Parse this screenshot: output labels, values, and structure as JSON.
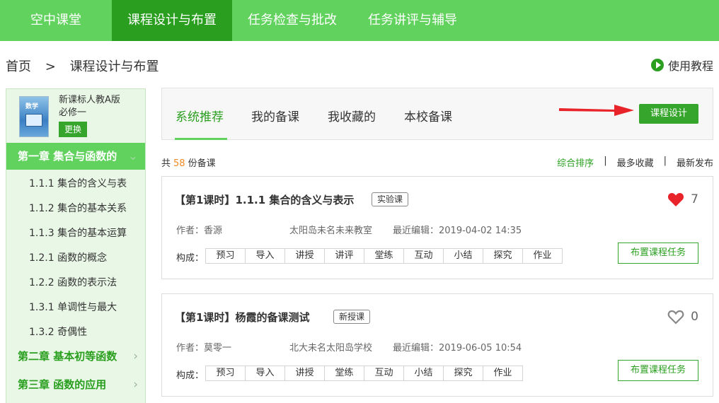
{
  "nav": {
    "brand": "空中课堂",
    "items": [
      "课程设计与布置",
      "任务检查与批改",
      "任务讲评与辅导"
    ]
  },
  "breadcrumb": {
    "home": "首页",
    "separator": ">",
    "current": "课程设计与布置"
  },
  "tutorial_link": "使用教程",
  "sidebar": {
    "book_cover_text": "数学",
    "book_title_line1": "新课标人教A版",
    "book_title_line2": "必修一",
    "swap_label": "更换",
    "chapters": [
      {
        "label": "第一章 集合与函数的",
        "active": true
      },
      {
        "label": "第二章 基本初等函数",
        "active": false
      },
      {
        "label": "第三章 函数的应用",
        "active": false
      }
    ],
    "sections": [
      "1.1.1 集合的含义与表",
      "1.1.2 集合的基本关系",
      "1.1.3 集合的基本运算",
      "1.2.1 函数的概念",
      "1.2.2 函数的表示法",
      "1.3.1 单调性与最大",
      "1.3.2 奇偶性"
    ]
  },
  "tabs": [
    "系统推荐",
    "我的备课",
    "我收藏的",
    "本校备课"
  ],
  "design_button": "课程设计",
  "summary": {
    "prefix": "共",
    "count": "58",
    "suffix": "份备课"
  },
  "sort_options": [
    "综合排序",
    "最多收藏",
    "最新发布"
  ],
  "labels": {
    "author": "作者：",
    "last_edit": "最近编辑：",
    "composition": "构成：",
    "assign": "布置课程任务"
  },
  "accent_color": "#62d25e",
  "dark_green": "#2a9f1f",
  "heart_color": "#e8242a",
  "cards": [
    {
      "title": "【第1课时】1.1.1 集合的含义与表示",
      "tag": "实验课",
      "liked": true,
      "likes": "7",
      "author": "香源",
      "school": "太阳岛未名未来教室",
      "edited": "2019-04-02 14:35",
      "parts": [
        "预习",
        "导入",
        "讲授",
        "讲评",
        "堂练",
        "互动",
        "小结",
        "探究",
        "作业"
      ]
    },
    {
      "title": "【第1课时】杨霞的备课测试",
      "tag": "新授课",
      "liked": false,
      "likes": "0",
      "author": "莫零一",
      "school": "北大未名太阳岛学校",
      "edited": "2019-06-05 10:54",
      "parts": [
        "预习",
        "导入",
        "讲授",
        "堂练",
        "互动",
        "小结",
        "探究",
        "作业"
      ]
    }
  ]
}
